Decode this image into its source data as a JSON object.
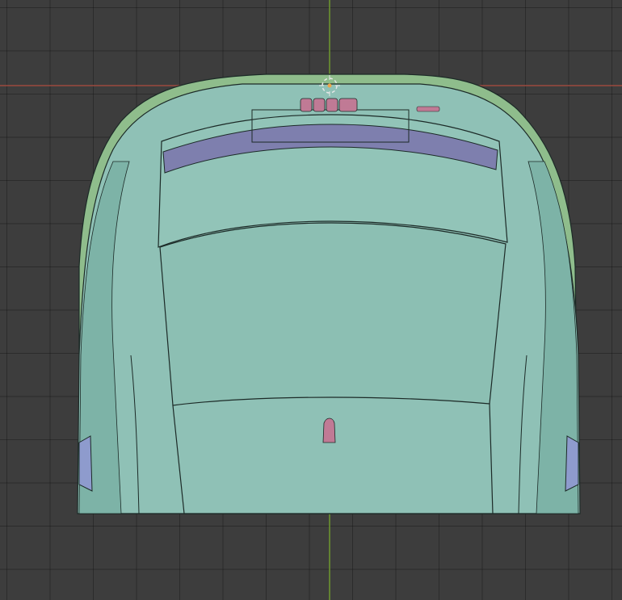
{
  "viewport": {
    "background_color": "#3d3d3d",
    "grid_line_color": "#2e2e2e",
    "x_axis_color": "#9b4a3f",
    "y_axis_color": "#6e9a2e"
  },
  "model": {
    "body_color": "#8fc1b6",
    "body_shade_color": "#6ea79b",
    "fender_color": "#8fbd8c",
    "spoiler_color": "#7e7fae",
    "accent_color": "#c07a95",
    "outline_color": "#1c2a27"
  },
  "cursor_3d": {
    "icon": "3d-cursor-icon",
    "ring_color": "#e7e7e7",
    "center_color": "#f0a64a"
  }
}
